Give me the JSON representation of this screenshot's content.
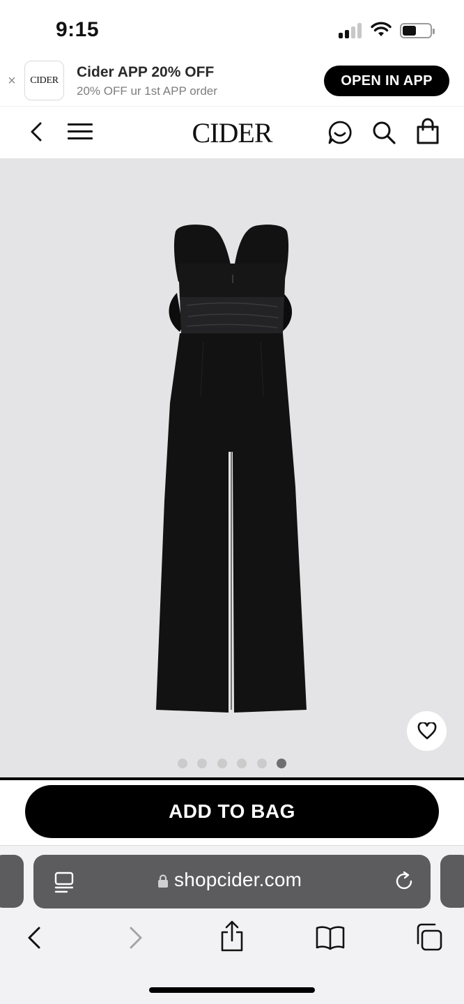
{
  "status_bar": {
    "time": "9:15",
    "signal_bars_active": 2,
    "signal_bars_total": 4,
    "battery_level": 0.45
  },
  "app_banner": {
    "close_glyph": "×",
    "logo_text": "CIDER",
    "title": "Cider APP 20% OFF",
    "subtitle": "20% OFF ur 1st APP order",
    "button_label": "OPEN IN APP"
  },
  "site_nav": {
    "logo": "CIDER",
    "icons": [
      "back-icon",
      "menu-icon",
      "chat-icon",
      "search-icon",
      "bag-icon"
    ]
  },
  "product": {
    "image_description_icon": "jumpsuit-image",
    "gallery_total": 6,
    "gallery_active_index": 5,
    "wishlist_icon": "heart-icon",
    "add_to_bag_label": "ADD TO BAG"
  },
  "browser": {
    "url": "shopcider.com",
    "icons": [
      "reader-icon",
      "lock-icon",
      "reload-icon"
    ],
    "toolbar": [
      "back-icon",
      "forward-icon",
      "share-icon",
      "bookmarks-icon",
      "tabs-icon"
    ]
  },
  "colors": {
    "primary": "#000000",
    "gallery_bg": "#e4e4e6",
    "address_bar": "#5c5c5e",
    "safari_bg": "#f2f2f4"
  }
}
